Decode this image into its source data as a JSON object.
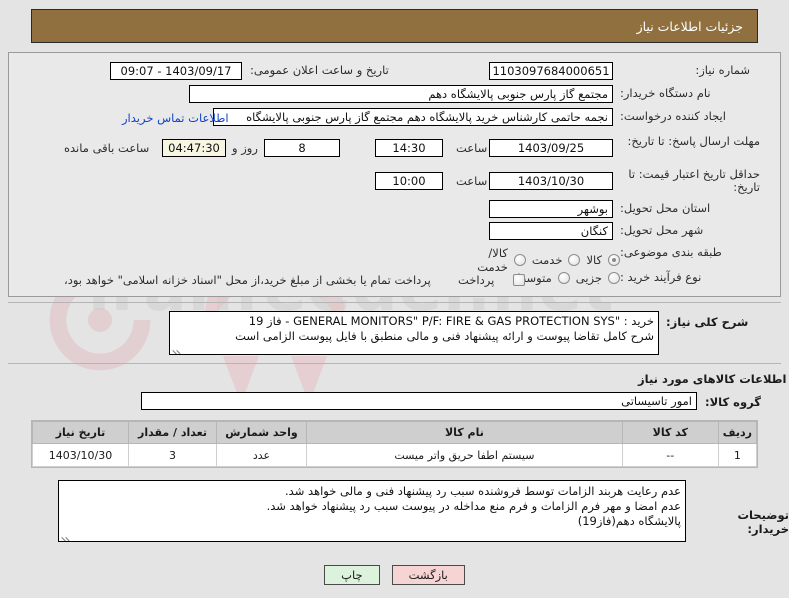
{
  "banner": {
    "title": "جزئیات اطلاعات نیاز"
  },
  "form": {
    "need_number": {
      "label": "شماره نیاز:",
      "value": "1103097684000651"
    },
    "public_announce": {
      "label": "تاریخ و ساعت اعلان عمومی:",
      "value": "1403/09/17 - 09:07"
    },
    "buyer_org": {
      "label": "نام دستگاه خریدار:",
      "value": "مجتمع گاز پارس جنوبی  پالایشگاه دهم"
    },
    "requester": {
      "label": "ایجاد کننده درخواست:",
      "value": "نجمه حاتمی کارشناس خرید پالایشگاه دهم  مجتمع گاز پارس جنوبی  پالایشگاه",
      "contact_link": "اطلاعات تماس خریدار"
    },
    "response_deadline": {
      "label": "مهلت ارسال پاسخ: تا تاریخ:",
      "date": "1403/09/25",
      "time_label": "ساعت",
      "time": "14:30",
      "days_value": "8",
      "days_label": "روز و",
      "remaining_value": "04:47:30",
      "remaining_label": "ساعت باقی مانده"
    },
    "price_validity": {
      "label": "حداقل تاریخ اعتبار قیمت: تا تاریخ:",
      "date": "1403/10/30",
      "time_label": "ساعت",
      "time": "10:00"
    },
    "province": {
      "label": "استان محل تحویل:",
      "value": "بوشهر"
    },
    "city": {
      "label": "شهر محل تحویل:",
      "value": "کنگان"
    },
    "classification": {
      "label": "طبقه بندی موضوعی:",
      "options": [
        {
          "label": "کالا",
          "checked": true
        },
        {
          "label": "خدمت",
          "checked": false
        },
        {
          "label": "کالا/خدمت",
          "checked": false
        }
      ]
    },
    "purchase_process": {
      "label": "نوع فرآیند خرید :",
      "options": [
        {
          "label": "جزیی",
          "checked": false
        },
        {
          "label": "متوسط",
          "checked": false
        }
      ],
      "payment_label": "پرداخت",
      "payment_note": "پرداخت تمام یا بخشی از مبلغ خرید،از محل \"اسناد خزانه اسلامی\" خواهد بود،"
    }
  },
  "description": {
    "label": "شرح کلی نیاز:",
    "lines": [
      "خرید : \"GENERAL MONITORS\" P/F: FIRE & GAS PROTECTION SYS - فاز 19",
      "شرح کامل تقاضا پیوست و ارائه پیشنهاد فنی و مالی منطبق با فایل پیوست الزامی است"
    ]
  },
  "goods_section": {
    "heading": "اطلاعات کالاهای مورد نیاز",
    "group": {
      "label": "گروه کالا:",
      "value": "امور تاسیساتی"
    },
    "table": {
      "headers": [
        "ردیف",
        "کد کالا",
        "نام کالا",
        "واحد شمارش",
        "تعداد / مقدار",
        "تاریخ نیاز"
      ],
      "rows": [
        {
          "row_no": "1",
          "code": "--",
          "name": "سیستم اطفا حریق واتر میست",
          "unit": "عدد",
          "qty": "3",
          "need_date": "1403/10/30"
        }
      ]
    }
  },
  "buyer_notes": {
    "label": "توضیحات خریدار:",
    "lines": [
      "عدم رعایت هربند الزامات توسط فروشنده سبب رد پیشنهاد فنی و مالی خواهد شد.",
      "عدم امضا و مهر فرم الزامات و فرم منع مداخله در پیوست سبب رد پیشنهاد خواهد شد.",
      "پالایشگاه دهم(فاز19)"
    ]
  },
  "buttons": {
    "print": "چاپ",
    "back": "بازگشت"
  },
  "watermark": {
    "text": "iranfeeder.net"
  },
  "colors": {
    "banner_bg": "#90703f",
    "panel_bg": "#e9e9e9",
    "page_bg": "#e4e4e4",
    "link": "#1342c8",
    "highlight_field": "#f7f6e2",
    "print_btn": "#ddf2dd",
    "back_btn": "#f7d4d4",
    "table_header": "#cfcfcf"
  }
}
